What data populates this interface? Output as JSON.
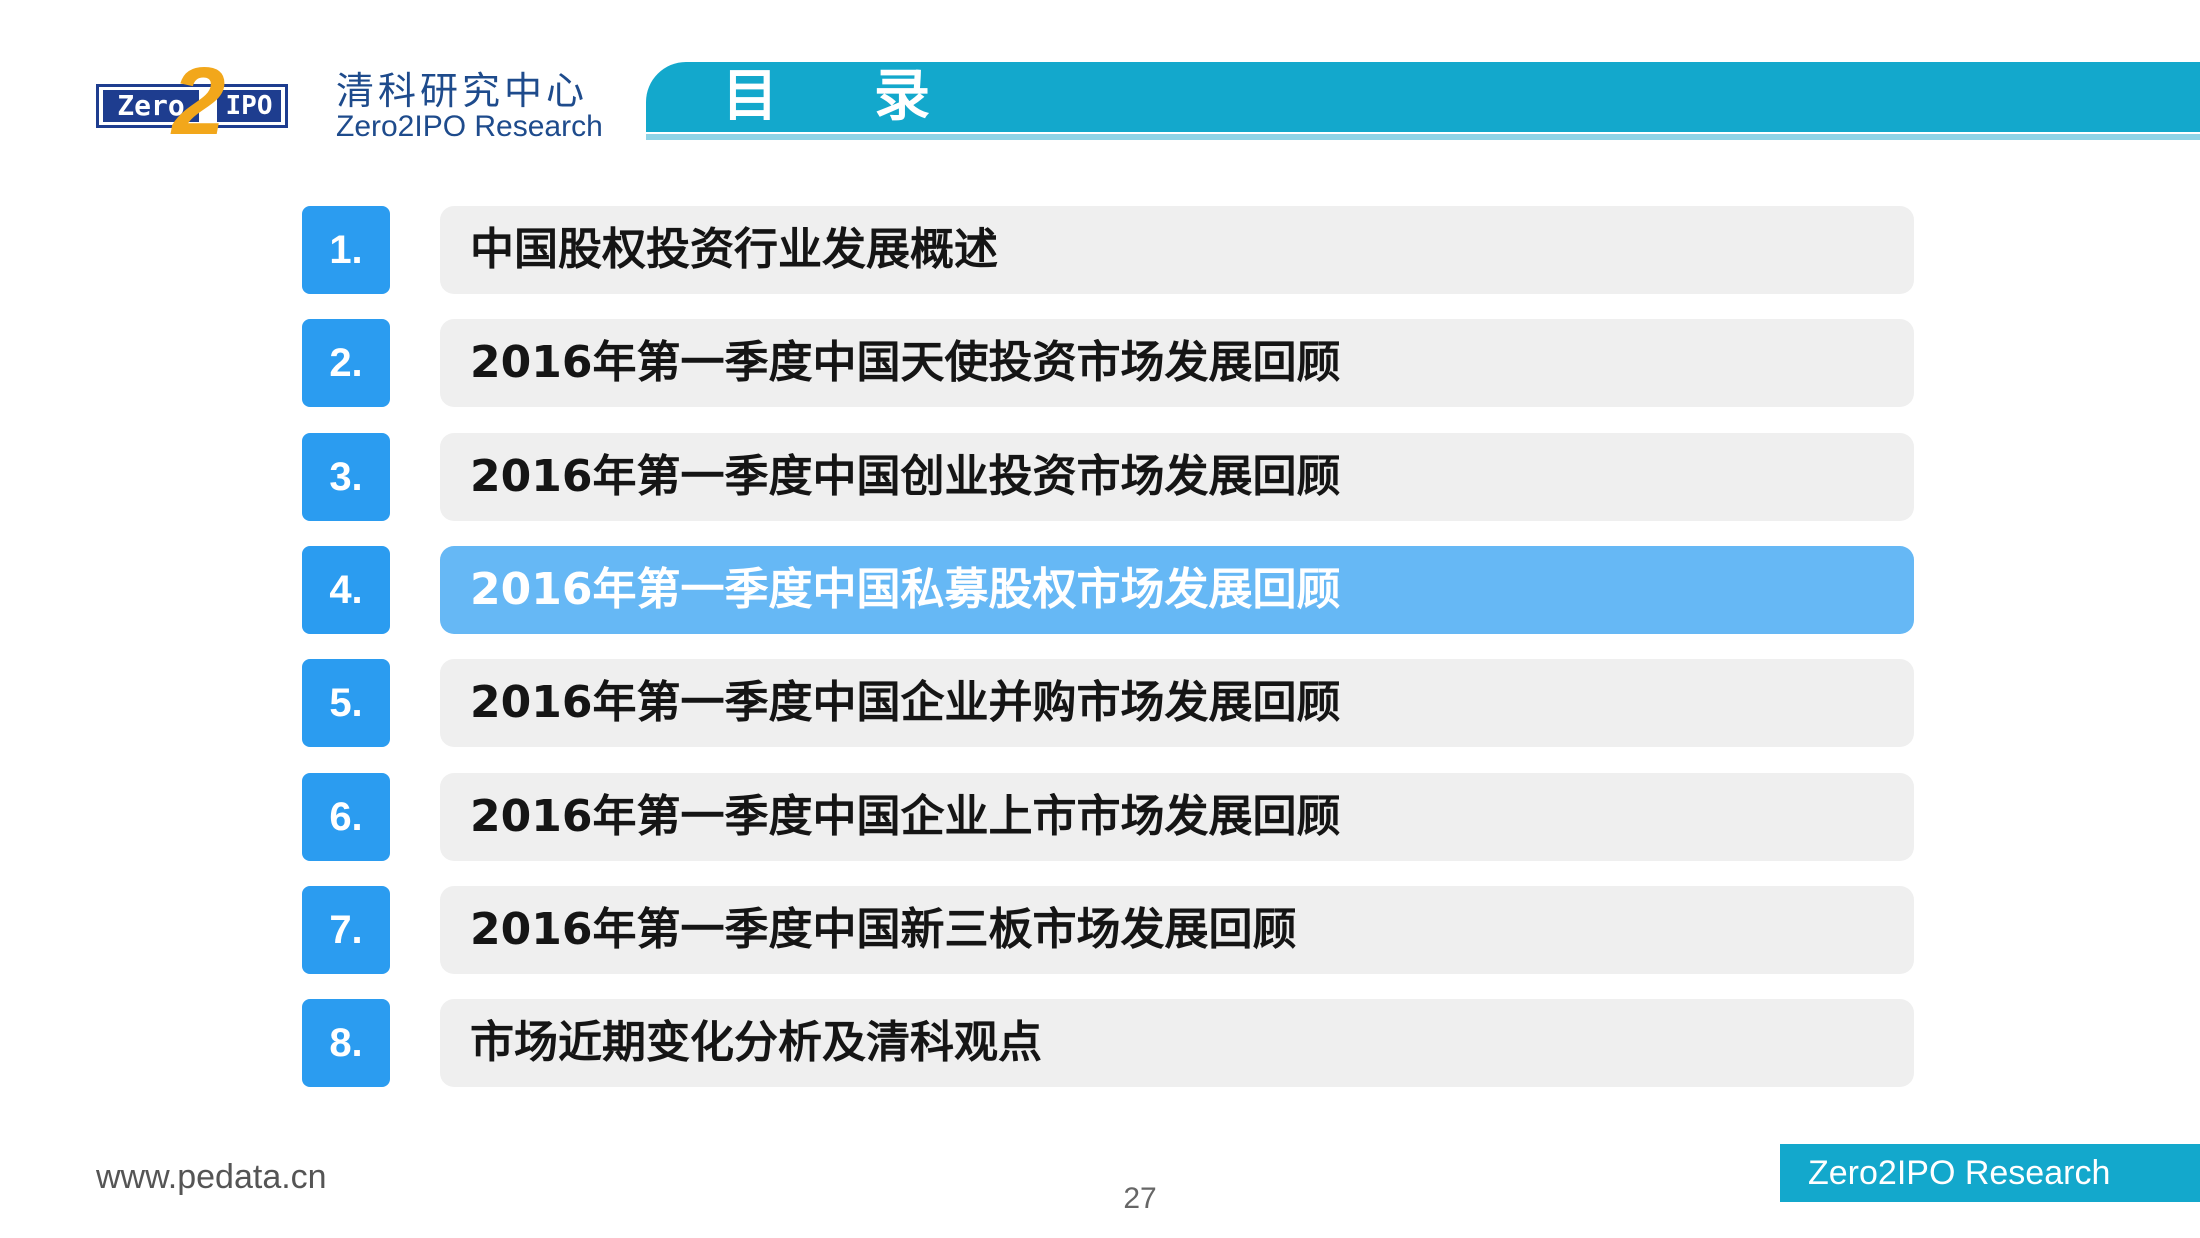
{
  "brand": {
    "logo_left": "Zero",
    "logo_mid": "2",
    "logo_right": "IPO",
    "name_cn": "清科研究中心",
    "name_en": "Zero2IPO Research"
  },
  "header": {
    "title": "目录"
  },
  "toc": {
    "items": [
      {
        "num": "1.",
        "label": "中国股权投资行业发展概述",
        "active": false
      },
      {
        "num": "2.",
        "label": "2016年第一季度中国天使投资市场发展回顾",
        "active": false
      },
      {
        "num": "3.",
        "label": "2016年第一季度中国创业投资市场发展回顾",
        "active": false
      },
      {
        "num": "4.",
        "label": "2016年第一季度中国私募股权市场发展回顾",
        "active": true
      },
      {
        "num": "5.",
        "label": "2016年第一季度中国企业并购市场发展回顾",
        "active": false
      },
      {
        "num": "6.",
        "label": "2016年第一季度中国企业上市市场发展回顾",
        "active": false
      },
      {
        "num": "7.",
        "label": "2016年第一季度中国新三板市场发展回顾",
        "active": false
      },
      {
        "num": "8.",
        "label": "市场近期变化分析及清科观点",
        "active": false
      }
    ]
  },
  "footer": {
    "url": "www.pedata.cn",
    "page": "27",
    "brand": "Zero2IPO Research"
  },
  "colors": {
    "accent": "#13a8cc",
    "number_box": "#2b9cf0",
    "active_bar": "#66b8f5",
    "bar": "#efefef"
  }
}
